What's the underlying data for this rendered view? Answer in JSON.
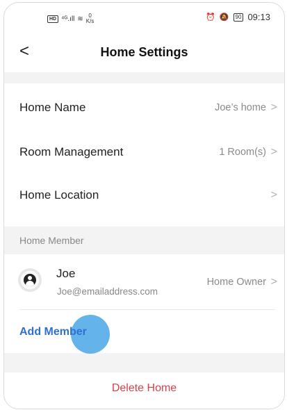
{
  "status_bar": {
    "left_hd": "HD",
    "left_signal": "⁴ᴳ.ıll",
    "left_wifi": "≋",
    "left_speed_value": "0",
    "left_speed_unit": "K/s",
    "right_alarm": "⏰",
    "right_mute": "🔕",
    "battery": "90",
    "time": "09:13"
  },
  "header": {
    "back_icon": "<",
    "title": "Home Settings"
  },
  "settings": {
    "home_name": {
      "label": "Home Name",
      "value": "Joe’s home"
    },
    "room_management": {
      "label": "Room Management",
      "value": "1 Room(s)"
    },
    "home_location": {
      "label": "Home Location",
      "value": ""
    }
  },
  "chevron": ">",
  "member_section": {
    "header": "Home Member",
    "members": [
      {
        "name": "Joe",
        "email": "Joe@emailaddress.com",
        "role": "Home Owner"
      }
    ],
    "add_label": "Add Member"
  },
  "delete_label": "Delete Home",
  "colors": {
    "accent_blue": "#2f6fd0",
    "danger_red": "#d9404a",
    "touch_indicator": "#4aa6e8",
    "section_gray": "#f3f3f3"
  }
}
